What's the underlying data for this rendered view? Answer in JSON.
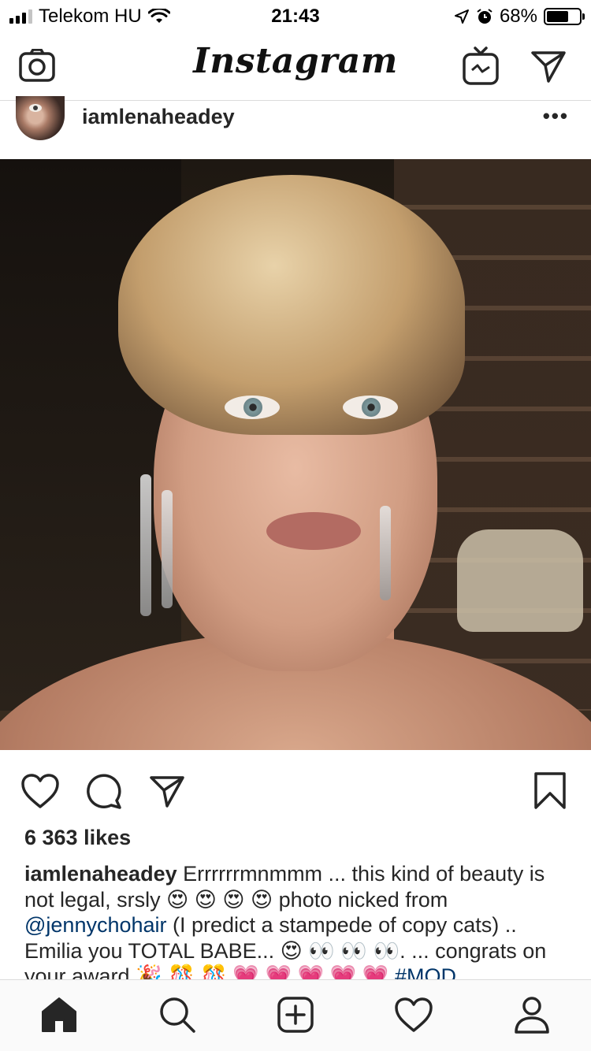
{
  "status_bar": {
    "carrier": "Telekom HU",
    "time": "21:43",
    "battery_percent": "68%",
    "battery_level": 0.68
  },
  "top_nav": {
    "logo": "Instagram",
    "left_icon": "camera-icon",
    "right_icons": [
      "igtv-icon",
      "direct-message-icon"
    ]
  },
  "post": {
    "username": "iamlenaheadey",
    "more_label": "•••",
    "likes": "6 363 likes",
    "caption": {
      "username": "iamlenaheadey",
      "part1": " Errrrrrmnmmm ... this kind of beauty is not legal, srsly 😍 😍 😍 😍 photo nicked from ",
      "mention": "@jennychohair",
      "part2": " (I predict a stampede of copy cats) .. Emilia you TOTAL BABE... 😍 👀 👀 👀. ... congrats on your award 🎉 🎊 🎊 💗 💗 💗 💗 💗 ",
      "hashtag": "#MOD"
    }
  },
  "tab_bar": {
    "items": [
      "home-icon",
      "search-icon",
      "new-post-icon",
      "activity-heart-icon",
      "profile-icon"
    ]
  },
  "colors": {
    "text": "#262626",
    "link": "#003569",
    "divider": "#dbdbdb",
    "tab_bg": "#fafafa"
  }
}
